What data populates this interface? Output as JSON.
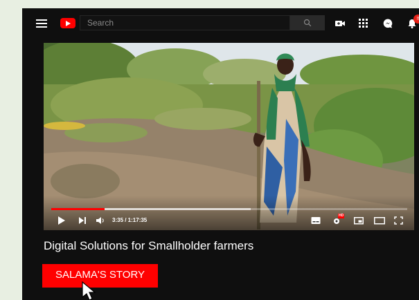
{
  "header": {
    "search_placeholder": "Search",
    "notification_count": "!!"
  },
  "player": {
    "time_display": "3:35 / 1:17:35",
    "played_fraction": 0.15,
    "buffered_fraction": 0.56,
    "hd_badge": "HD"
  },
  "video": {
    "title": "Digital Solutions for Smallholder farmers"
  },
  "cta": {
    "label": "SALAMA'S STORY"
  },
  "colors": {
    "brand_red": "#ff0000",
    "background": "#0f0f0f"
  },
  "icons": [
    "menu-icon",
    "youtube-logo",
    "search-icon",
    "video-camera-icon",
    "apps-grid-icon",
    "messages-icon",
    "bell-icon",
    "play-icon",
    "next-icon",
    "volume-icon",
    "subtitles-icon",
    "settings-icon",
    "miniplayer-icon",
    "theater-icon",
    "fullscreen-icon",
    "cursor-icon"
  ]
}
